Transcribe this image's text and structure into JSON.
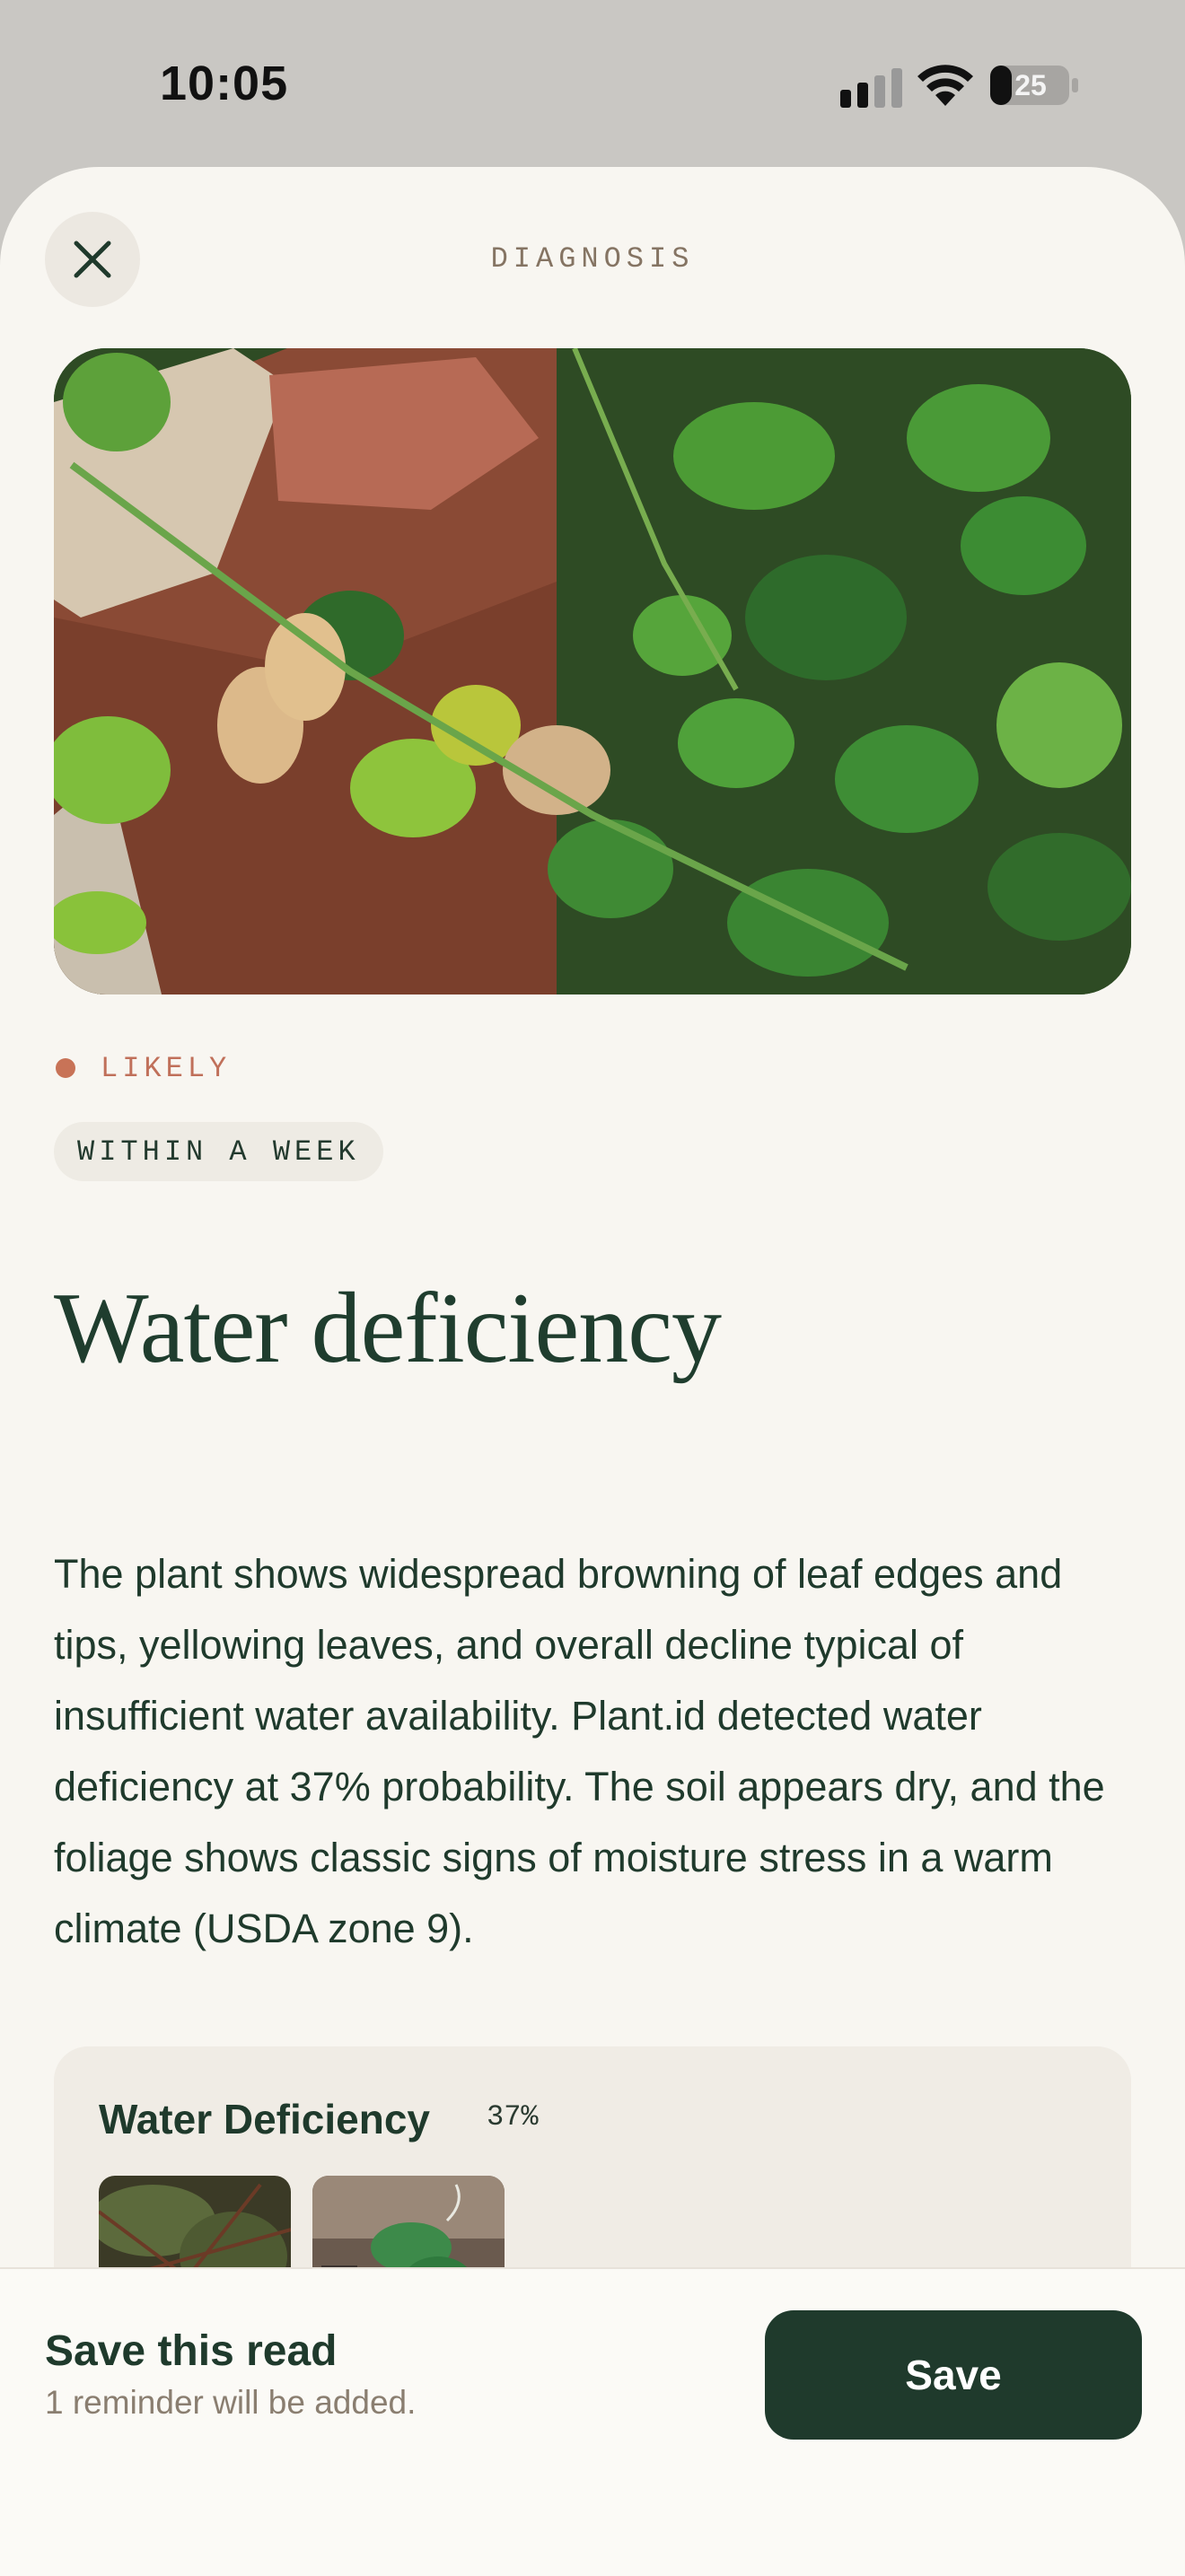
{
  "status_bar": {
    "time": "10:05",
    "battery_level": "25",
    "icons": [
      "signal-icon",
      "wifi-icon",
      "battery-icon"
    ]
  },
  "sheet": {
    "title": "DIAGNOSIS",
    "close_icon": "close-icon"
  },
  "diagnosis": {
    "likelihood": "LIKELY",
    "urgency": "WITHIN A WEEK",
    "name": "Water deficiency",
    "description": "The plant shows widespread browning of leaf edges and tips, yellowing leaves, and overall decline typical of insufficient water availability. Plant.id detected water deficiency at 37% probability. The soil appears dry, and the foliage shows classic signs of moisture stress in a warm climate (USDA zone 9)."
  },
  "result_card": {
    "name": "Water Deficiency",
    "probability": "37%",
    "thumbnails": [
      "dried-plant-image",
      "wilted-pothos-image"
    ]
  },
  "footer": {
    "title": "Save this read",
    "subtitle": "1 reminder will be added.",
    "save_label": "Save"
  },
  "colors": {
    "accent_dark_green": "#1f3a2c",
    "likely_dot": "#c87357",
    "sheet_background": "#f8f6f1",
    "card_background": "#f0ece5"
  }
}
